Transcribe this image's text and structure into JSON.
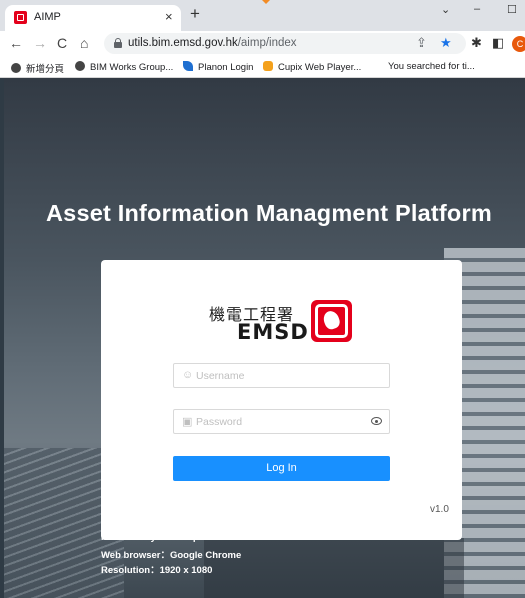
{
  "browser": {
    "tab_title": "AIMP",
    "tab_close": "×",
    "new_tab": "+",
    "window_controls": {
      "chevron": "⌄",
      "minimize": "–",
      "maximize": "☐"
    },
    "url_host": "utils.bim.emsd.gov.hk",
    "url_path": "/aimp/index",
    "profile_initial": "C",
    "bookmarks": [
      {
        "label": "新增分頁",
        "icon": "globe-icon",
        "color": "#444444"
      },
      {
        "label": "BIM Works Group...",
        "icon": "globe-icon",
        "color": "#444444"
      },
      {
        "label": "Planon Login",
        "icon": "planon-icon",
        "color": "#1f6fd1"
      },
      {
        "label": "Cupix Web Player...",
        "icon": "cupix-icon",
        "color": "#f4a11c"
      },
      {
        "label": "You searched for ti...",
        "icon": "",
        "color": ""
      }
    ]
  },
  "page": {
    "title": "Asset Information Managment Platform",
    "logo": {
      "chinese": "機電工程署",
      "english": "EMSD",
      "brand_color": "#e4001b"
    },
    "username_placeholder": "Username",
    "password_placeholder": "Password",
    "login_label": "Log In",
    "version": "v1.0",
    "accent_color": "#1890ff",
    "requirements": {
      "heading": "Minimum system requirements",
      "browser": "Web browser：Google Chrome",
      "resolution": "Resolution：1920 x 1080"
    }
  }
}
